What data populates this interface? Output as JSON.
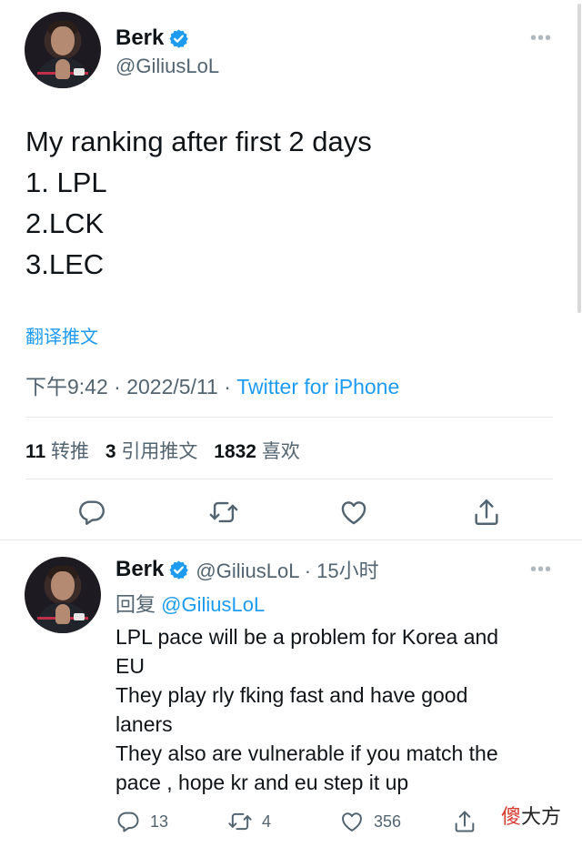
{
  "colors": {
    "accent": "#1d9bf0",
    "text": "#0f1419",
    "muted": "#536471",
    "divider": "#e7e9ea",
    "watermark_red": "#d63a2f"
  },
  "main_tweet": {
    "display_name": "Berk",
    "handle": "@GiliusLoL",
    "verified_icon": "verified-badge-icon",
    "more_icon": "more-dots-icon",
    "more_glyph": "•••",
    "text_lines": [
      "My ranking after first 2 days",
      "1. LPL",
      "2.LCK",
      "3.LEC"
    ],
    "translate_label": "翻译推文",
    "timestamp": "下午9:42 · 2022/5/11 · ",
    "source": "Twitter for iPhone",
    "stats": {
      "retweets_count": "11",
      "retweets_label": "转推",
      "quotes_count": "3",
      "quotes_label": "引用推文",
      "likes_count": "1832",
      "likes_label": "喜欢"
    },
    "actions": [
      "reply-icon",
      "retweet-icon",
      "like-icon",
      "share-icon"
    ]
  },
  "reply_tweet": {
    "display_name": "Berk",
    "handle_time": "@GiliusLoL · 15小时",
    "replying_label": "回复 ",
    "replying_mention": "@GiliusLoL",
    "text_lines": [
      "LPL pace will be a problem for Korea and",
      "EU",
      "They play rly fking fast and have good",
      "laners",
      "They also are vulnerable if you match the",
      "pace , hope kr and eu step it up"
    ],
    "reply_count": "13",
    "retweet_count": "4",
    "like_count": "356"
  },
  "watermark": {
    "char1": "傻",
    "rest": "大方"
  }
}
